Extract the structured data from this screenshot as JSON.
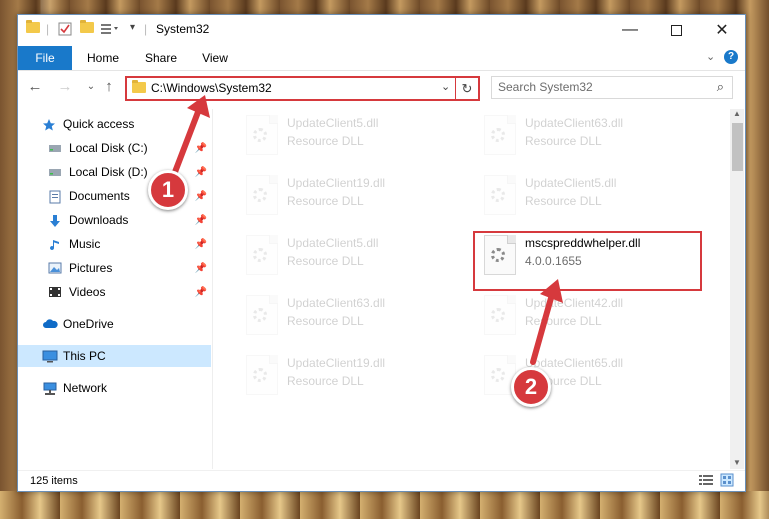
{
  "window": {
    "title": "System32"
  },
  "ribbon": {
    "tabs": [
      "File",
      "Home",
      "Share",
      "View"
    ]
  },
  "address": {
    "path": "C:\\Windows\\System32"
  },
  "search": {
    "placeholder": "Search System32"
  },
  "sidebar": {
    "items": [
      {
        "label": "Quick access",
        "icon": "star-icon"
      },
      {
        "label": "Local Disk (C:)",
        "icon": "drive-icon",
        "pinned": true
      },
      {
        "label": "Local Disk (D:)",
        "icon": "drive-icon",
        "pinned": true
      },
      {
        "label": "Documents",
        "icon": "documents-icon",
        "pinned": true
      },
      {
        "label": "Downloads",
        "icon": "download-icon",
        "pinned": true
      },
      {
        "label": "Music",
        "icon": "music-icon",
        "pinned": true
      },
      {
        "label": "Pictures",
        "icon": "pictures-icon",
        "pinned": true
      },
      {
        "label": "Videos",
        "icon": "videos-icon",
        "pinned": true
      },
      {
        "label": "OneDrive",
        "icon": "cloud-icon"
      },
      {
        "label": "This PC",
        "icon": "computer-icon",
        "selected": true
      },
      {
        "label": "Network",
        "icon": "network-icon"
      }
    ]
  },
  "files": [
    {
      "name": "UpdateClient5.dll",
      "desc": "Resource DLL",
      "faded": true
    },
    {
      "name": "UpdateClient63.dll",
      "desc": "Resource DLL",
      "faded": true
    },
    {
      "name": "UpdateClient19.dll",
      "desc": "Resource DLL",
      "faded": true
    },
    {
      "name": "UpdateClient5.dll",
      "desc": "Resource DLL",
      "faded": true
    },
    {
      "name": "UpdateClient5.dll",
      "desc": "Resource DLL",
      "faded": true
    },
    {
      "name": "mscspreddwhelper.dll",
      "desc": "4.0.0.1655",
      "faded": false
    },
    {
      "name": "UpdateClient63.dll",
      "desc": "Resource DLL",
      "faded": true
    },
    {
      "name": "UpdateClient42.dll",
      "desc": "Resource DLL",
      "faded": true
    },
    {
      "name": "UpdateClient19.dll",
      "desc": "Resource DLL",
      "faded": true
    },
    {
      "name": "UpdateClient65.dll",
      "desc": "Resource DLL",
      "faded": true
    }
  ],
  "status": {
    "items_count": "125 items"
  },
  "callouts": [
    "1",
    "2"
  ],
  "colors": {
    "accent": "#1979ca",
    "highlight": "#d6393d",
    "selection": "#cce8ff"
  }
}
